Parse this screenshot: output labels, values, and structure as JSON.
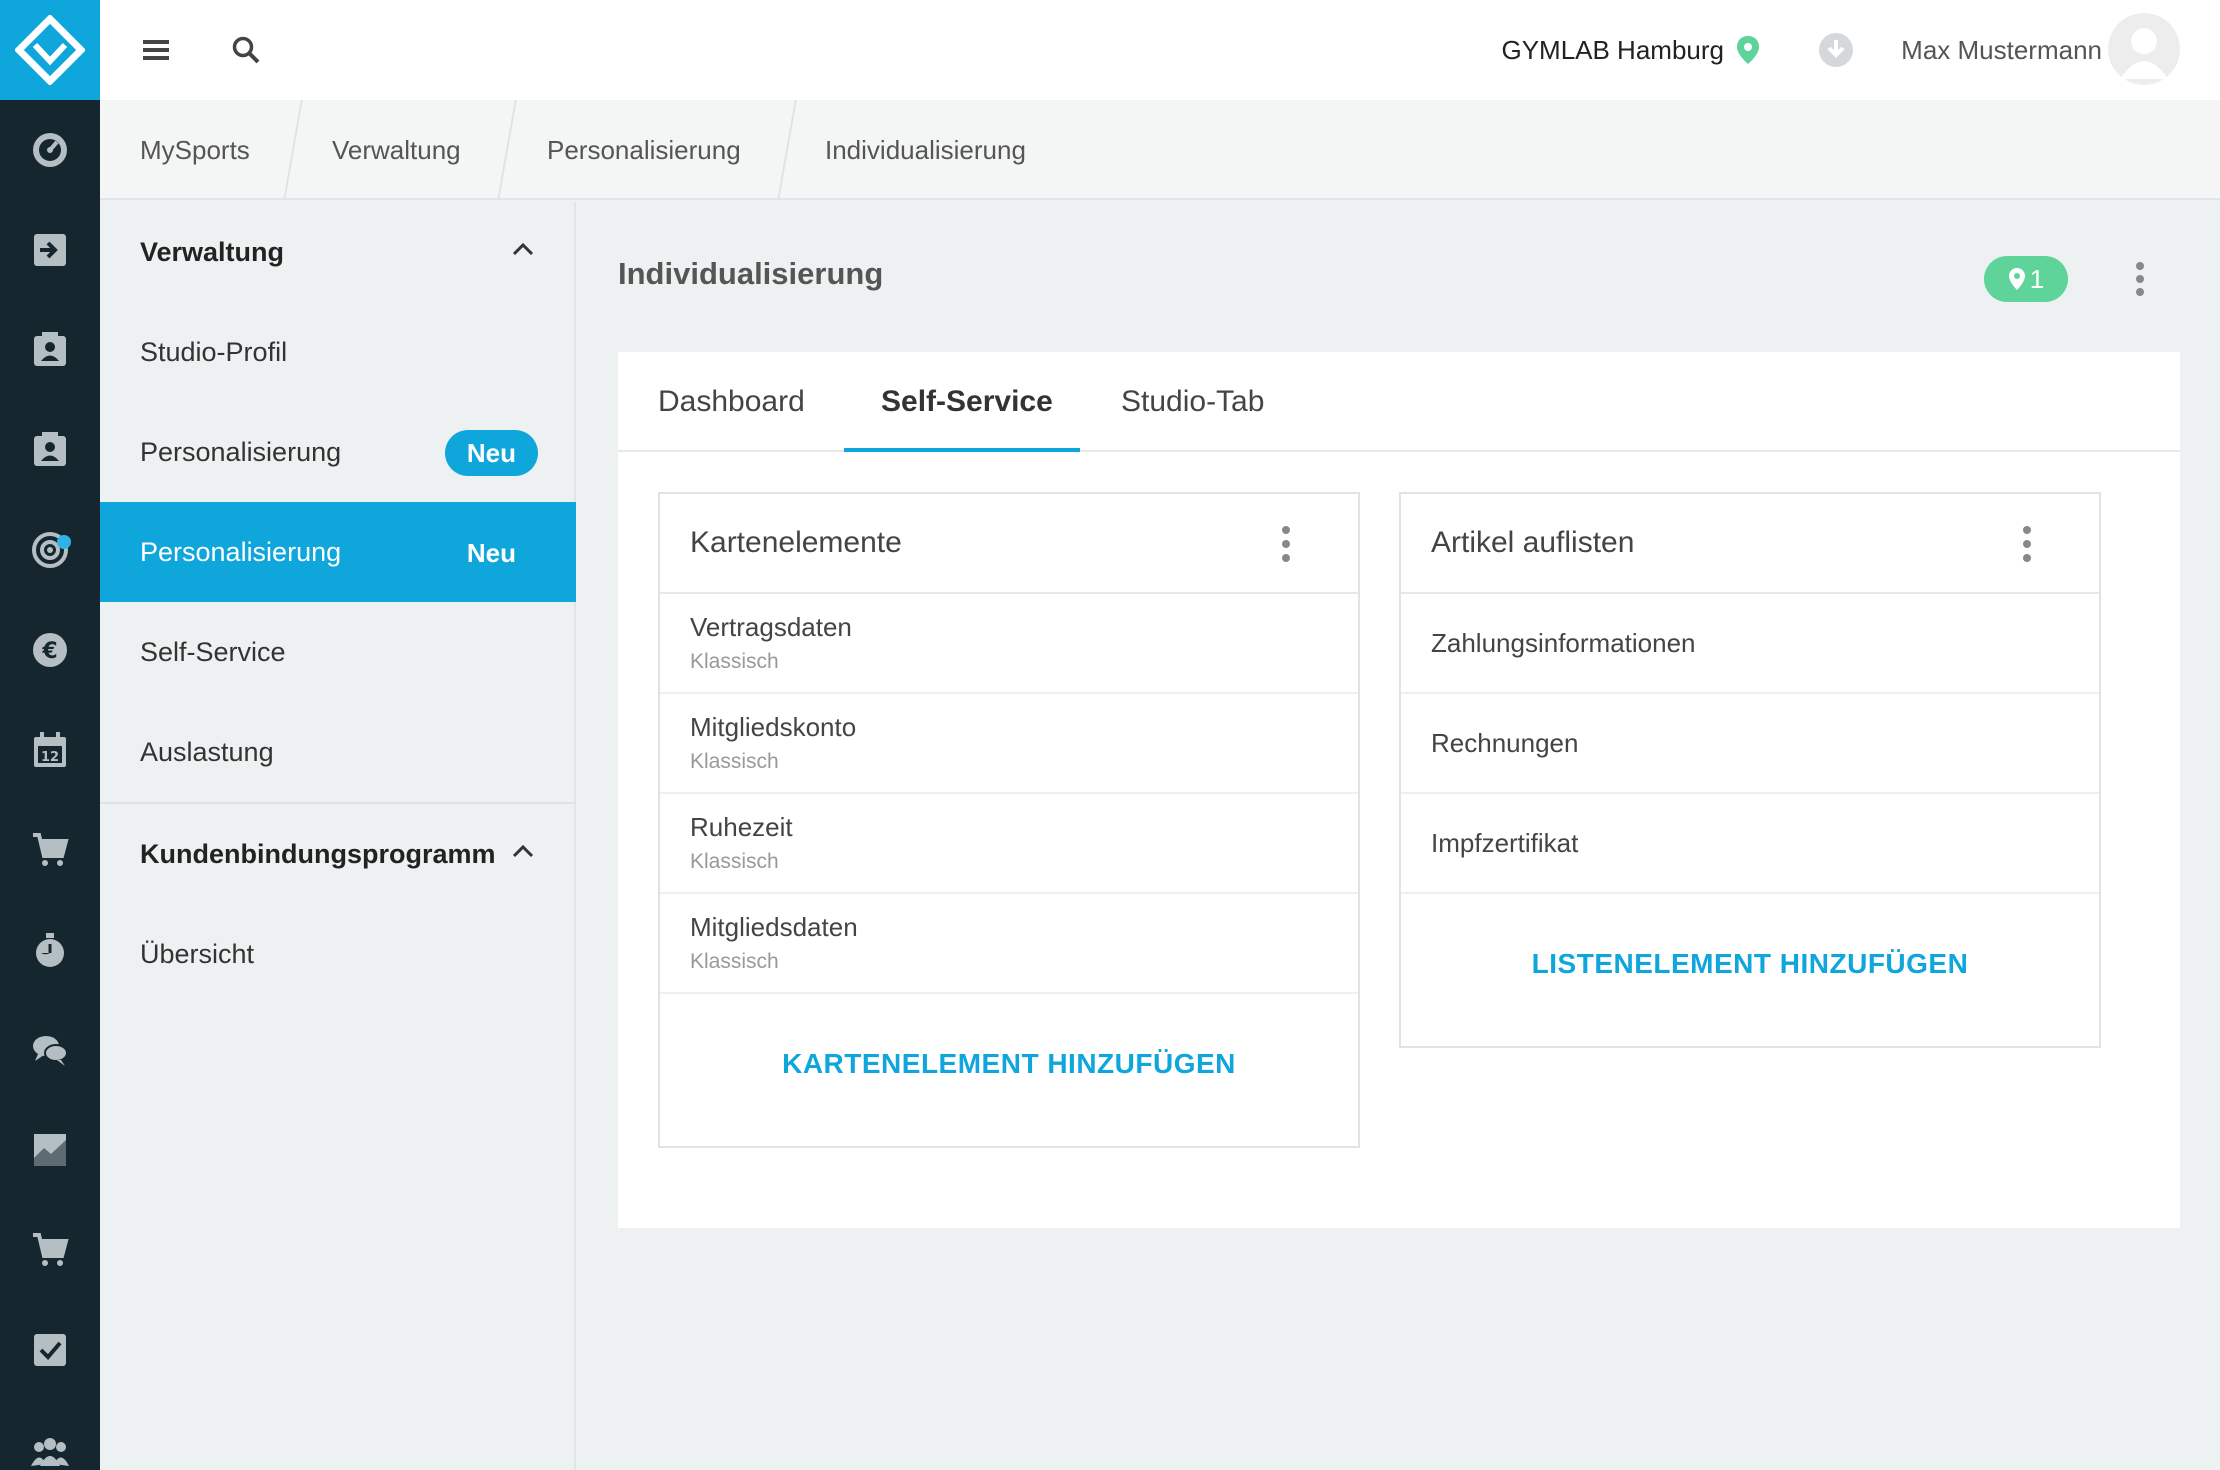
{
  "topbar": {
    "studio": "GYMLAB Hamburg",
    "user_name": "Max Mustermann"
  },
  "breadcrumb": [
    "MySports",
    "Verwaltung",
    "Personalisierung",
    "Individualisierung"
  ],
  "sidebar": {
    "group1_title": "Verwaltung",
    "items": [
      {
        "label": "Studio-Profil"
      },
      {
        "label": "Personalisierung",
        "badge": "Neu"
      },
      {
        "label": "Personalisierung",
        "badge": "Neu",
        "active": true
      },
      {
        "label": "Self-Service"
      },
      {
        "label": "Auslastung"
      }
    ],
    "group2_title": "Kundenbindungsprogramm",
    "group2_items": [
      {
        "label": "Übersicht"
      }
    ]
  },
  "main": {
    "title": "Individualisierung",
    "location_count": "1",
    "tabs": [
      "Dashboard",
      "Self-Service",
      "Studio-Tab"
    ],
    "active_tab": "Self-Service",
    "card_left": {
      "title": "Kartenelemente",
      "rows": [
        {
          "title": "Vertragsdaten",
          "sub": "Klassisch"
        },
        {
          "title": "Mitgliedskonto",
          "sub": "Klassisch"
        },
        {
          "title": "Ruhezeit",
          "sub": "Klassisch"
        },
        {
          "title": "Mitgliedsdaten",
          "sub": "Klassisch"
        }
      ],
      "action": "KARTENELEMENT HINZUFÜGEN"
    },
    "card_right": {
      "title": "Artikel auflisten",
      "rows": [
        {
          "title": "Zahlungsinformationen"
        },
        {
          "title": "Rechnungen"
        },
        {
          "title": "Impfzertifikat"
        }
      ],
      "action": "LISTENELEMENT HINZUFÜGEN"
    }
  },
  "colors": {
    "accent": "#0fa6dc",
    "rail": "#16262f",
    "location_green": "#5fd49a"
  },
  "icons": {
    "rail": [
      "logo-icon",
      "dashboard-icon",
      "checkin-icon",
      "member-card-icon",
      "member-card-icon",
      "target-icon",
      "euro-icon",
      "calendar-icon",
      "cart-icon",
      "stopwatch-icon",
      "chat-icon",
      "chart-icon",
      "cart-icon",
      "checkbox-icon",
      "group-icon"
    ]
  }
}
